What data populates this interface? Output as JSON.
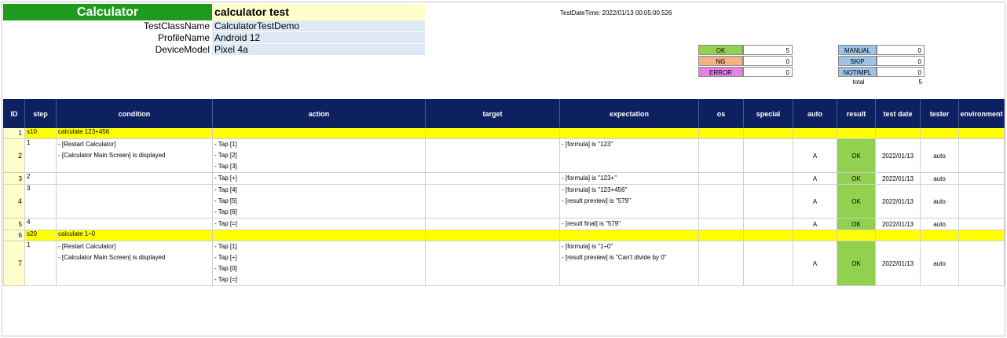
{
  "header": {
    "title": "Calculator",
    "subtitle": "calculator test",
    "info": [
      {
        "label": "TestClassName",
        "value": "CalculatorTestDemo"
      },
      {
        "label": "ProfileName",
        "value": "Android 12"
      },
      {
        "label": "DeviceModel",
        "value": "Pixel 4a"
      }
    ],
    "datetime": "TestDateTime: 2022/01/13 00:05:00.526"
  },
  "summary": {
    "left": [
      {
        "label": "OK",
        "value": "5",
        "color": "#92d050"
      },
      {
        "label": "NG",
        "value": "0",
        "color": "#f4b183"
      },
      {
        "label": "ERROR",
        "value": "0",
        "color": "#e682e6"
      }
    ],
    "right": [
      {
        "label": "MANUAL",
        "value": "0",
        "color": "#9dc3e6"
      },
      {
        "label": "SKIP",
        "value": "0",
        "color": "#9dc3e6"
      },
      {
        "label": "NOTIMPL",
        "value": "0",
        "color": "#9dc3e6"
      }
    ],
    "total_label": "total",
    "total_value": "5"
  },
  "table": {
    "headers": [
      "ID",
      "step",
      "condition",
      "action",
      "target",
      "expectation",
      "os",
      "special",
      "auto",
      "result",
      "test date",
      "tester",
      "environment"
    ],
    "rows": [
      {
        "id": "1",
        "section": true,
        "step": "s10",
        "condition": "calculate 123+456"
      },
      {
        "id": "2",
        "step": "1",
        "condition": [
          "- [Restart Calculator]",
          "- [Calculator Main Screen] is displayed"
        ],
        "action": [
          "- Tap [1]",
          "- Tap [2]",
          "- Tap [3]"
        ],
        "expectation": [
          "- [formula] is \"123\""
        ],
        "auto": "A",
        "result": "OK",
        "date": "2022/01/13",
        "tester": "auto"
      },
      {
        "id": "3",
        "step": "2",
        "condition": [],
        "action": [
          "- Tap [+]"
        ],
        "expectation": [
          "- [formula] is \"123+\""
        ],
        "auto": "A",
        "result": "OK",
        "date": "2022/01/13",
        "tester": "auto"
      },
      {
        "id": "4",
        "step": "3",
        "condition": [],
        "action": [
          "- Tap [4]",
          "- Tap [5]",
          "- Tap [6]"
        ],
        "expectation": [
          "- [formula] is \"123+456\"",
          "- [result preview] is \"579\""
        ],
        "auto": "A",
        "result": "OK",
        "date": "2022/01/13",
        "tester": "auto"
      },
      {
        "id": "5",
        "step": "4",
        "condition": [],
        "action": [
          "- Tap [=]"
        ],
        "expectation": [
          "- [result final] is \"579\""
        ],
        "auto": "A",
        "result": "OK",
        "date": "2022/01/13",
        "tester": "auto"
      },
      {
        "id": "6",
        "section": true,
        "step": "s20",
        "condition": "calculate 1÷0"
      },
      {
        "id": "7",
        "step": "1",
        "condition": [
          "- [Restart Calculator]",
          "- [Calculator Main Screen] is displayed"
        ],
        "action": [
          "- Tap [1]",
          "- Tap [÷]",
          "- Tap [0]",
          "- Tap [=]"
        ],
        "expectation": [
          "- [formula] is \"1÷0\"",
          "- [result preview] is \"Can't divide by 0\""
        ],
        "auto": "A",
        "result": "OK",
        "date": "2022/01/13",
        "tester": "auto"
      }
    ]
  }
}
